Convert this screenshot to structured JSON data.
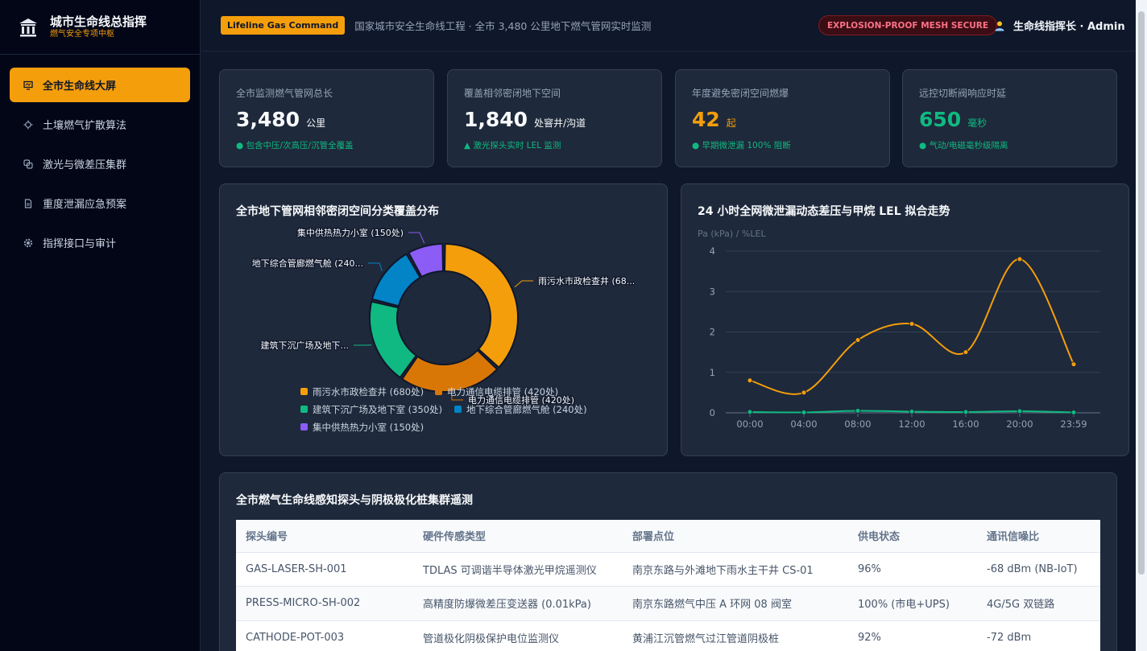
{
  "sidebar": {
    "title": "城市生命线总指挥",
    "subtitle": "燃气安全专项中枢",
    "items": [
      {
        "label": "全市生命线大屏",
        "icon": "monitor-icon"
      },
      {
        "label": "土壤燃气扩散算法",
        "icon": "gear-icon"
      },
      {
        "label": "激光与微差压集群",
        "icon": "layers-icon"
      },
      {
        "label": "重度泄漏应急预案",
        "icon": "document-icon"
      },
      {
        "label": "指挥接口与审计",
        "icon": "settings-icon"
      }
    ]
  },
  "header": {
    "badge": "Lifeline Gas Command",
    "title": "国家城市安全生命线工程 · 全市 3,480 公里地下燃气管网实时监测",
    "secure": "EXPLOSION-PROOF MESH SECURE",
    "user": "生命线指挥长 · Admin"
  },
  "kpis": [
    {
      "label": "全市监测燃气管网总长",
      "value": "3,480",
      "unit": "公里",
      "note": "● 包含中压/次高压/沉管全覆盖",
      "color": "#f8fafc"
    },
    {
      "label": "覆盖相邻密闭地下空间",
      "value": "1,840",
      "unit": "处窨井/沟道",
      "note": "▲ 激光探头实时 LEL 监测",
      "color": "#f8fafc"
    },
    {
      "label": "年度避免密闭空间燃爆",
      "value": "42",
      "unit": "起",
      "note": "● 早期微泄漏 100% 阻断",
      "color": "#f59e0b"
    },
    {
      "label": "远控切断阀响应时延",
      "value": "650",
      "unit": "毫秒",
      "note": "● 气动/电磁毫秒级隔离",
      "color": "#10b981"
    }
  ],
  "donut_panel": {
    "title": "全市地下管网相邻密闭空间分类覆盖分布"
  },
  "line_panel": {
    "title": "24 小时全网微泄漏动态差压与甲烷 LEL 拟合走势",
    "unit_label": "Pa (kPa) / %LEL"
  },
  "chart_data": [
    {
      "type": "pie",
      "title": "全市地下管网相邻密闭空间分类覆盖分布",
      "categories": [
        "雨污水市政检查井 (680处)",
        "电力通信电缆排管 (420处)",
        "建筑下沉广场及地下室 (350处)",
        "地下综合管廊燃气舱 (240处)",
        "集中供热热力小室 (150处)"
      ],
      "callouts": [
        "雨污水市政检查井 (68...",
        "电力通信电缆排管 (420处)",
        "建筑下沉广场及地下...",
        "地下综合管廊燃气舱 (240...",
        "集中供热热力小室 (150处)"
      ],
      "values": [
        680,
        420,
        350,
        240,
        150
      ],
      "colors": [
        "#f59e0b",
        "#d97706",
        "#10b981",
        "#0284c7",
        "#8b5cf6"
      ],
      "legend": "bottom"
    },
    {
      "type": "line",
      "title": "24 小时全网微泄漏动态差压与甲烷 LEL 拟合走势",
      "ylabel": "Pa (kPa) / %LEL",
      "x": [
        "00:00",
        "04:00",
        "08:00",
        "12:00",
        "16:00",
        "20:00",
        "23:59"
      ],
      "ylim": [
        0,
        4
      ],
      "yticks": [
        0,
        1,
        2,
        3,
        4
      ],
      "series": [
        {
          "values": [
            0.8,
            0.5,
            1.8,
            2.2,
            1.5,
            3.8,
            1.2
          ],
          "color": "#f59e0b"
        },
        {
          "values": [
            0.02,
            0.01,
            0.05,
            0.03,
            0.02,
            0.04,
            0.01
          ],
          "color": "#10b981"
        }
      ],
      "grid": true
    }
  ],
  "table": {
    "title": "全市燃气生命线感知探头与阴极极化桩集群遥测",
    "headers": [
      "探头编号",
      "硬件传感类型",
      "部署点位",
      "供电状态",
      "通讯信噪比"
    ],
    "rows": [
      [
        "GAS-LASER-SH-001",
        "TDLAS 可调谐半导体激光甲烷遥测仪",
        "南京东路与外滩地下雨水主干井 CS-01",
        "96%",
        "-68 dBm (NB-IoT)"
      ],
      [
        "PRESS-MICRO-SH-002",
        "高精度防爆微差压变送器 (0.01kPa)",
        "南京东路燃气中压 A 环网 08 阀室",
        "100% (市电+UPS)",
        "4G/5G 双链路"
      ],
      [
        "CATHODE-POT-003",
        "管道极化阴极保护电位监测仪",
        "黄浦江沉管燃气过江管道阴极桩",
        "92%",
        "-72 dBm"
      ]
    ]
  }
}
